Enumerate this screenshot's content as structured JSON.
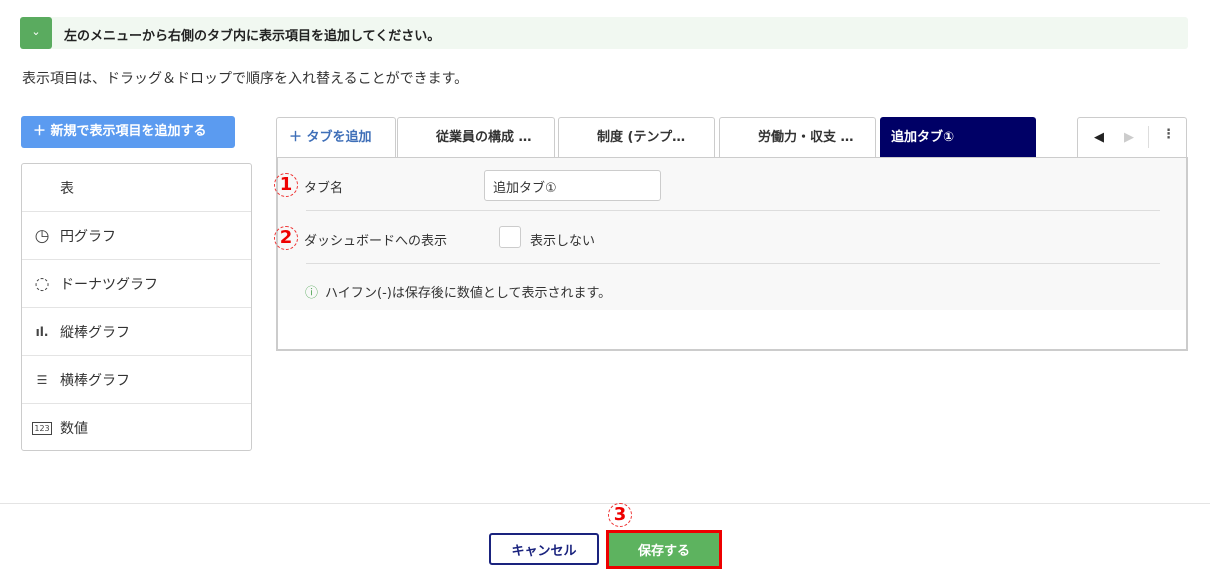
{
  "notice": {
    "text": "左のメニューから右側のタブ内に表示項目を追加してください。"
  },
  "subtitle": "表示項目は、ドラッグ＆ドロップで順序を入れ替えることができます。",
  "add_item_button": "＋ 新規で表示項目を追加する",
  "items": [
    {
      "label": "表",
      "icon": "table-icon"
    },
    {
      "label": "円グラフ",
      "icon": "pie-chart-icon"
    },
    {
      "label": "ドーナツグラフ",
      "icon": "donut-chart-icon"
    },
    {
      "label": "縦棒グラフ",
      "icon": "bar-chart-icon"
    },
    {
      "label": "横棒グラフ",
      "icon": "horizontal-bar-icon"
    },
    {
      "label": "数値",
      "icon": "number-icon",
      "icon_text": "123"
    }
  ],
  "tabs": {
    "add": "＋ タブを追加",
    "list": [
      "従業員の構成 …",
      "制度 (テンプ…",
      "労働力・収支 …",
      "追加タブ①"
    ]
  },
  "form": {
    "tab_name_label": "タブ名",
    "tab_name_value": "追加タブ①",
    "dashboard_label": "ダッシュボードへの表示",
    "dashboard_checkbox": "表示しない",
    "note": "ハイフン(-)は保存後に数値として表示されます。"
  },
  "annotations": [
    "1",
    "2",
    "3"
  ],
  "footer": {
    "cancel": "キャンセル",
    "save": "保存する"
  }
}
